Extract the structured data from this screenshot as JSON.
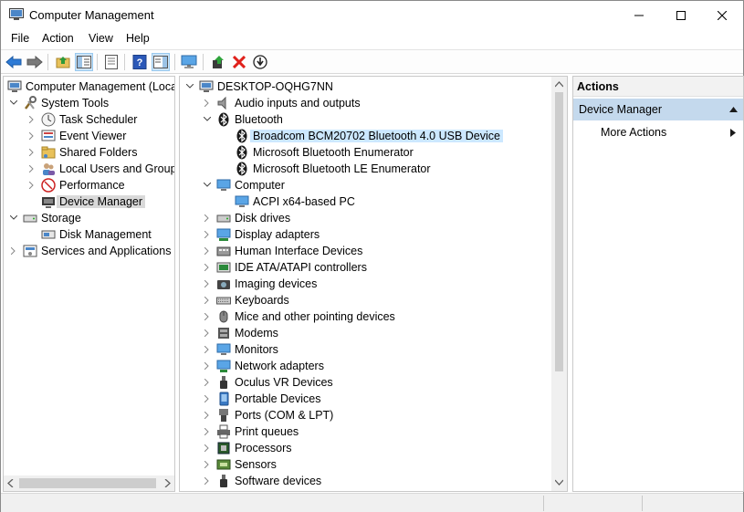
{
  "window": {
    "title": "Computer Management"
  },
  "menu": [
    "File",
    "Action",
    "View",
    "Help"
  ],
  "toolbar": {
    "icons": [
      "back-icon",
      "forward-icon",
      "up-folder-icon",
      "show-hide-tree-icon",
      "properties-icon",
      "help-icon",
      "show-hide-action-pane-icon",
      "monitor-icon",
      "update-driver-icon",
      "uninstall-icon",
      "download-icon"
    ]
  },
  "left_tree": [
    {
      "label": "Computer Management (Local",
      "expanded": true
    },
    {
      "label": "System Tools",
      "expanded": true
    },
    {
      "label": "Task Scheduler"
    },
    {
      "label": "Event Viewer"
    },
    {
      "label": "Shared Folders"
    },
    {
      "label": "Local Users and Groups"
    },
    {
      "label": "Performance"
    },
    {
      "label": "Device Manager",
      "selected": true
    },
    {
      "label": "Storage",
      "expanded": true
    },
    {
      "label": "Disk Management"
    },
    {
      "label": "Services and Applications"
    }
  ],
  "device_tree": {
    "root": "DESKTOP-OQHG7NN",
    "items": [
      {
        "label": "Audio inputs and outputs"
      },
      {
        "label": "Bluetooth",
        "expanded": true
      },
      {
        "label": "Broadcom BCM20702 Bluetooth 4.0 USB Device",
        "selected": true
      },
      {
        "label": "Microsoft Bluetooth Enumerator"
      },
      {
        "label": "Microsoft Bluetooth LE Enumerator"
      },
      {
        "label": "Computer",
        "expanded": true
      },
      {
        "label": "ACPI x64-based PC"
      },
      {
        "label": "Disk drives"
      },
      {
        "label": "Display adapters"
      },
      {
        "label": "Human Interface Devices"
      },
      {
        "label": "IDE ATA/ATAPI controllers"
      },
      {
        "label": "Imaging devices"
      },
      {
        "label": "Keyboards"
      },
      {
        "label": "Mice and other pointing devices"
      },
      {
        "label": "Modems"
      },
      {
        "label": "Monitors"
      },
      {
        "label": "Network adapters"
      },
      {
        "label": "Oculus VR Devices"
      },
      {
        "label": "Portable Devices"
      },
      {
        "label": "Ports (COM & LPT)"
      },
      {
        "label": "Print queues"
      },
      {
        "label": "Processors"
      },
      {
        "label": "Sensors"
      },
      {
        "label": "Software devices"
      }
    ]
  },
  "actions": {
    "header": "Actions",
    "section": "Device Manager",
    "items": [
      "More Actions"
    ]
  },
  "colors": {
    "selection_gray": "#d9d9d9",
    "selection_blue": "#cce8ff",
    "actions_section": "#c4d9ed",
    "bluetooth": "#1a1a1a",
    "uninstall_red": "#e0211b"
  }
}
